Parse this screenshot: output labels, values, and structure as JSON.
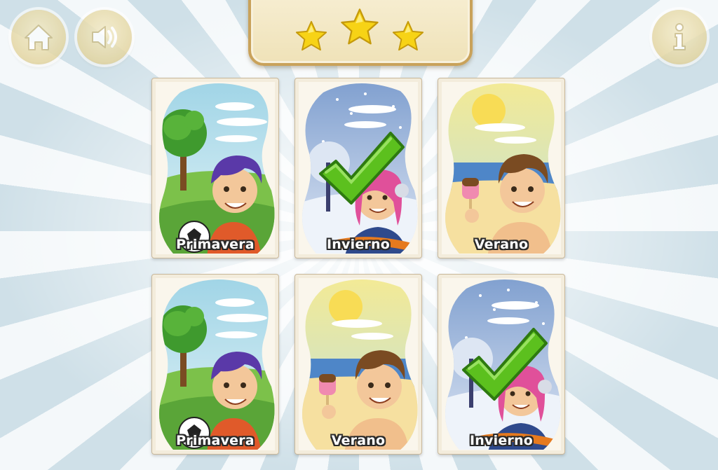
{
  "header": {
    "buttons": {
      "home": "home-icon",
      "sound": "speaker-icon",
      "info": "info-icon"
    },
    "stars": {
      "earned": 3,
      "total": 3
    }
  },
  "cards": [
    {
      "label": "Primavera",
      "season": "spring",
      "matched": false
    },
    {
      "label": "Invierno",
      "season": "winter",
      "matched": true
    },
    {
      "label": "Verano",
      "season": "summer",
      "matched": false
    },
    {
      "label": "Primavera",
      "season": "spring",
      "matched": false
    },
    {
      "label": "Verano",
      "season": "summer",
      "matched": false
    },
    {
      "label": "Invierno",
      "season": "winter",
      "matched": true
    }
  ],
  "colors": {
    "star": "#f7d316",
    "check": "#5cc01e",
    "button": "#e4d6a2",
    "panel_border": "#c9a25a"
  }
}
